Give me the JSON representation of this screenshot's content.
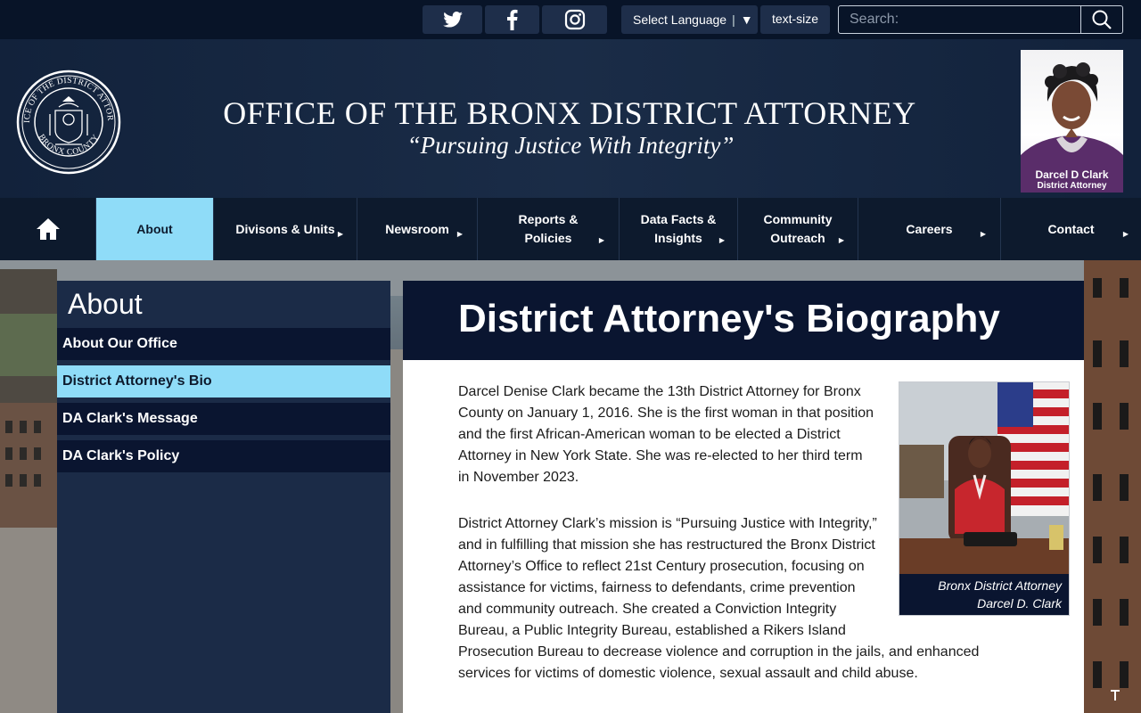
{
  "topbar": {
    "social": [
      {
        "name": "twitter"
      },
      {
        "name": "facebook"
      },
      {
        "name": "instagram"
      }
    ],
    "language_label": "Select Language",
    "language_caret": "▼",
    "text_size_label": "text-size",
    "search_placeholder": "Search:"
  },
  "header": {
    "seal_text_top": "OFFICE OF THE DISTRICT ATTORNEY",
    "seal_text_bottom": "BRONX COUNTY",
    "title": "OFFICE OF THE BRONX DISTRICT ATTORNEY",
    "tagline": "“Pursuing Justice With Integrity”",
    "da_name": "Darcel D Clark",
    "da_title": "District Attorney"
  },
  "nav": {
    "items": [
      {
        "label": ""
      },
      {
        "label": "About"
      },
      {
        "label": "Divisons & Units"
      },
      {
        "label": "Newsroom"
      },
      {
        "label": "Reports &\nPolicies"
      },
      {
        "label": "Data Facts &\nInsights"
      },
      {
        "label": "Community\nOutreach"
      },
      {
        "label": "Careers"
      },
      {
        "label": "Contact"
      }
    ]
  },
  "sidebar": {
    "heading": "About",
    "items": [
      {
        "label": "About Our Office"
      },
      {
        "label": "District Attorney's Bio"
      },
      {
        "label": "DA Clark's Message"
      },
      {
        "label": "DA Clark's Policy"
      }
    ]
  },
  "main": {
    "title": "District Attorney's Biography",
    "para1": "Darcel Denise Clark became the 13th District Attorney for Bronx County on January 1, 2016. She is the first woman in that position and the first African-American woman to be elected a District Attorney in New York State. She was re-elected to her third term in November 2023.",
    "para2_lines": [
      "District Attorney Clark’s mission is “Pursuing Justice with Integrity,”",
      "and in fulfilling that mission she has restructured the Bronx District",
      "Attorney’s Office to reflect 21st Century prosecution, focusing on",
      "assistance for victims, fairness to defendants, crime prevention",
      "and community outreach. She created a Conviction Integrity",
      "Bureau, a Public Integrity Bureau, established a Rikers Island",
      "Prosecution Bureau to decrease violence and corruption in the jails, and enhanced",
      "services for victims of domestic violence, sexual assault and child abuse."
    ],
    "figure_caption_line1": "Bronx District Attorney",
    "figure_caption_line2": "Darcel D. Clark"
  },
  "colors": {
    "navy": "#0d1a2d",
    "accent": "#8fdcf8",
    "panel": "#1b2b47"
  }
}
